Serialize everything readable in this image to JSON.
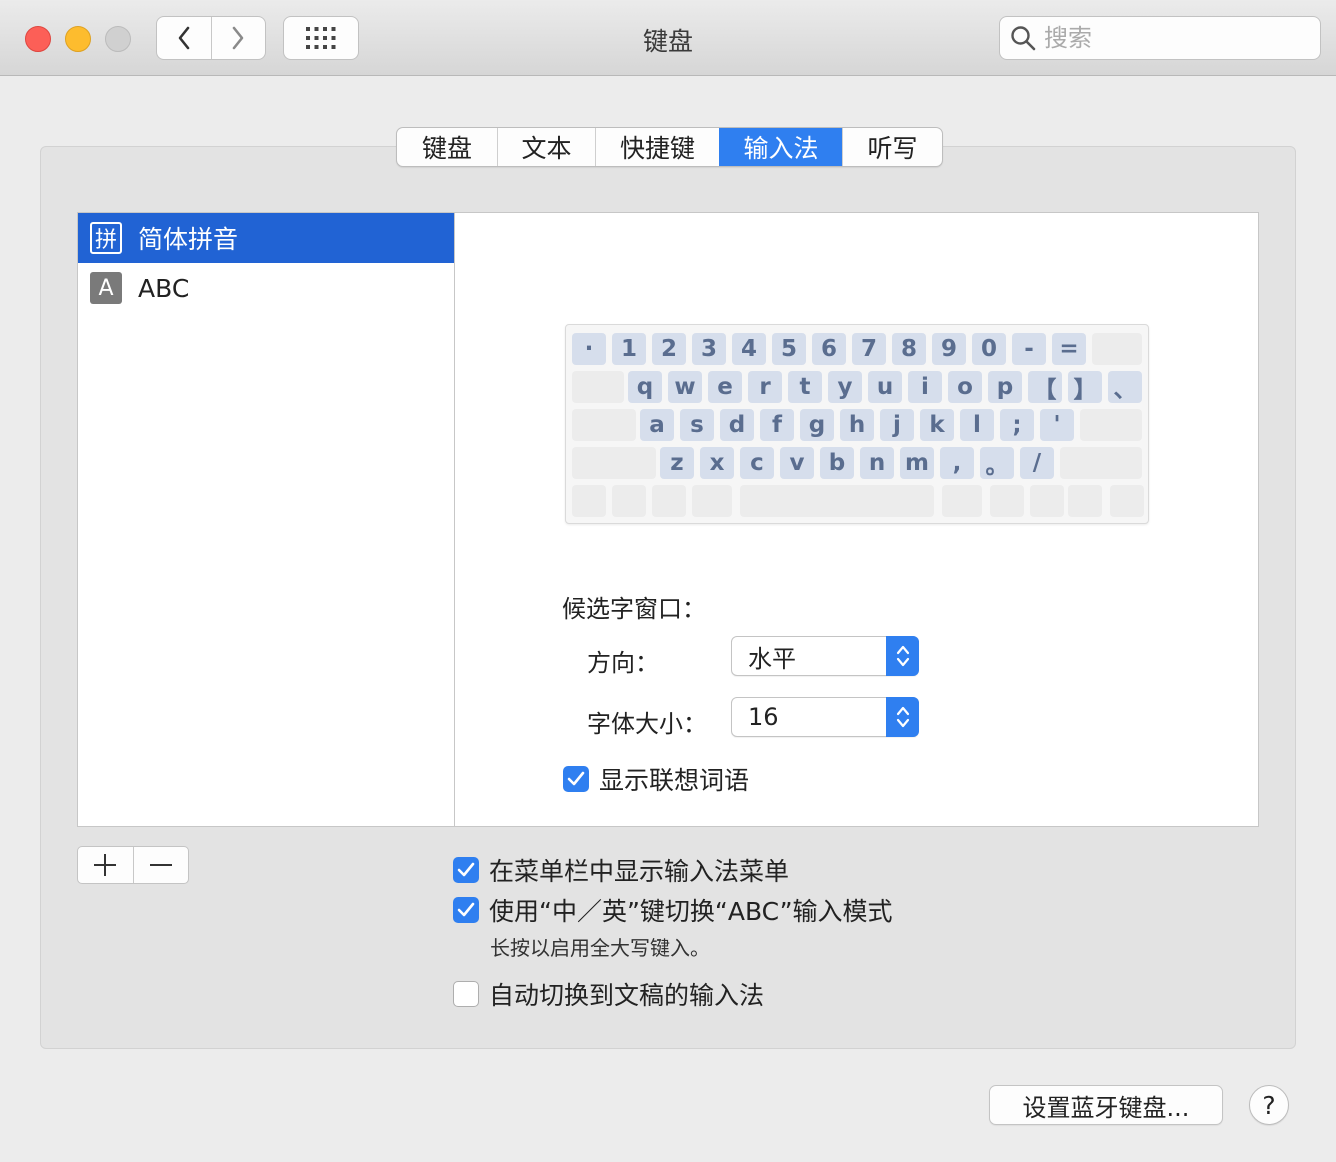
{
  "window": {
    "title": "键盘"
  },
  "search": {
    "placeholder": "搜索"
  },
  "tabs": [
    {
      "label": "键盘",
      "active": false
    },
    {
      "label": "文本",
      "active": false
    },
    {
      "label": "快捷键",
      "active": false
    },
    {
      "label": "输入法",
      "active": true
    },
    {
      "label": "听写",
      "active": false
    }
  ],
  "input_sources": [
    {
      "icon_text": "拼",
      "icon": "pinyin-icon",
      "label": "简体拼音",
      "selected": true
    },
    {
      "icon_text": "A",
      "icon": "abc-icon",
      "label": "ABC",
      "selected": false
    }
  ],
  "keyboard": {
    "row1": [
      "·",
      "1",
      "2",
      "3",
      "4",
      "5",
      "6",
      "7",
      "8",
      "9",
      "0",
      "-",
      "="
    ],
    "row2": [
      "q",
      "w",
      "e",
      "r",
      "t",
      "y",
      "u",
      "i",
      "o",
      "p",
      "【",
      "】",
      "、"
    ],
    "row3": [
      "a",
      "s",
      "d",
      "f",
      "g",
      "h",
      "j",
      "k",
      "l",
      ";",
      "'"
    ],
    "row4": [
      "z",
      "x",
      "c",
      "v",
      "b",
      "n",
      "m",
      ",",
      "。",
      "/"
    ]
  },
  "candidate": {
    "section_label": "候选字窗口：",
    "direction_label": "方向：",
    "direction_value": "水平",
    "font_size_label": "字体大小：",
    "font_size_value": "16",
    "show_predictions_label": "显示联想词语",
    "show_predictions_checked": true
  },
  "options": {
    "show_menu_label": "在菜单栏中显示输入法菜单",
    "show_menu_checked": true,
    "caps_switch_label": "使用“中／英”键切换“ABC”输入模式",
    "caps_switch_checked": true,
    "caps_note": "长按以启用全大写键入。",
    "auto_switch_label": "自动切换到文稿的输入法",
    "auto_switch_checked": false
  },
  "buttons": {
    "add": "+",
    "remove": "−",
    "bluetooth": "设置蓝牙键盘...",
    "help": "?"
  },
  "colors": {
    "accent": "#2f7ff0",
    "selection": "#2163d4",
    "key_fill": "#d6deec",
    "key_text": "#5a6d8f"
  }
}
